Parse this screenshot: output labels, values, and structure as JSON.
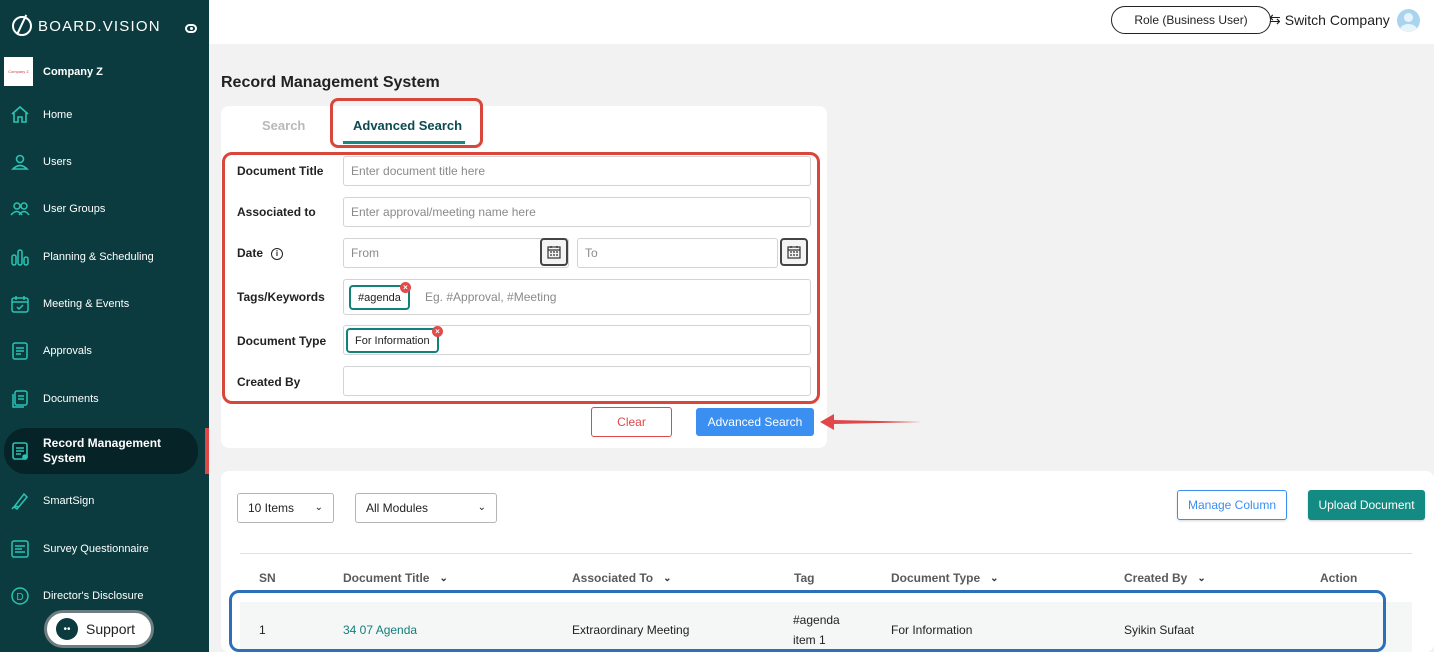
{
  "app": {
    "logo_text": "BOARD.VISION"
  },
  "company": {
    "name": "Company Z",
    "logo_text": "Company Z"
  },
  "sidebar": {
    "items": [
      {
        "label": "Home",
        "icon": "home-icon"
      },
      {
        "label": "Users",
        "icon": "user-icon"
      },
      {
        "label": "User Groups",
        "icon": "users-icon"
      },
      {
        "label": "Planning & Scheduling",
        "icon": "chart-bars-icon"
      },
      {
        "label": "Meeting & Events",
        "icon": "calendar-icon"
      },
      {
        "label": "Approvals",
        "icon": "document-check-icon"
      },
      {
        "label": "Documents",
        "icon": "documents-icon"
      },
      {
        "label": "Record Management System",
        "icon": "record-icon",
        "active": true
      },
      {
        "label": "SmartSign",
        "icon": "pen-icon"
      },
      {
        "label": "Survey Questionnaire",
        "icon": "survey-icon"
      },
      {
        "label": "Director's Disclosure",
        "icon": "disclosure-icon"
      }
    ],
    "support_label": "Support"
  },
  "header": {
    "role_label": "Role (Business User)",
    "switch_label": "Switch Company"
  },
  "page": {
    "title": "Record Management System"
  },
  "tabs": [
    {
      "label": "Search",
      "active": false
    },
    {
      "label": "Advanced Search",
      "active": true
    }
  ],
  "form": {
    "document_title": {
      "label": "Document Title",
      "placeholder": "Enter document title here",
      "value": ""
    },
    "associated_to": {
      "label": "Associated to",
      "placeholder": "Enter approval/meeting name here",
      "value": ""
    },
    "date": {
      "label": "Date",
      "from_placeholder": "From",
      "to_placeholder": "To"
    },
    "tags": {
      "label": "Tags/Keywords",
      "chips": [
        "#agenda"
      ],
      "placeholder": "Eg. #Approval, #Meeting"
    },
    "document_type": {
      "label": "Document Type",
      "chips": [
        "For Information"
      ]
    },
    "created_by": {
      "label": "Created By",
      "value": ""
    },
    "clear_label": "Clear",
    "search_label": "Advanced Search"
  },
  "results": {
    "page_size": "10 Items",
    "module_filter": "All Modules",
    "manage_column_label": "Manage Column",
    "upload_label": "Upload Document",
    "columns": [
      "SN",
      "Document Title",
      "Associated To",
      "Tag",
      "Document Type",
      "Created By",
      "Action"
    ],
    "rows": [
      {
        "sn": "1",
        "title": "34 07 Agenda",
        "associated_to": "Extraordinary Meeting",
        "tag_line1": "#agenda",
        "tag_line2": "item 1",
        "document_type": "For Information",
        "created_by": "Syikin Sufaat"
      }
    ]
  },
  "colors": {
    "sidebar_bg": "#0b3b3f",
    "accent_teal": "#138a82",
    "primary_blue": "#3a8ff0",
    "danger_red": "#e0474a",
    "annotation_red": "#d9473a",
    "annotation_blue": "#2d6fba"
  }
}
